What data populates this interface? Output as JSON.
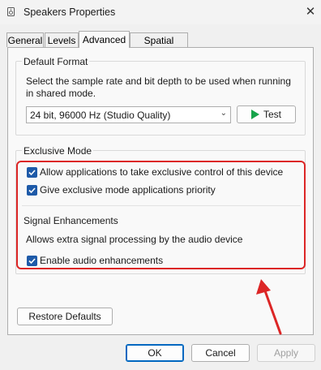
{
  "window": {
    "title": "Speakers Properties",
    "close_glyph": "✕"
  },
  "tabs": [
    {
      "label": "General"
    },
    {
      "label": "Levels"
    },
    {
      "label": "Advanced"
    },
    {
      "label": "Spatial sound"
    }
  ],
  "default_format": {
    "group_title": "Default Format",
    "description_line1": "Select the sample rate and bit depth to be used when running",
    "description_line2": "in shared mode.",
    "selected_format": "24 bit, 96000 Hz (Studio Quality)",
    "test_label": "Test"
  },
  "exclusive_mode": {
    "group_title": "Exclusive Mode",
    "allow_exclusive_label": "Allow applications to take exclusive control of this device",
    "allow_exclusive_checked": true,
    "priority_label": "Give exclusive mode applications priority",
    "priority_checked": true
  },
  "signal_enhancements": {
    "group_title": "Signal Enhancements",
    "description": "Allows extra signal processing by the audio device",
    "enable_label": "Enable audio enhancements",
    "enable_checked": true
  },
  "buttons": {
    "restore_defaults": "Restore Defaults",
    "ok": "OK",
    "cancel": "Cancel",
    "apply": "Apply"
  },
  "colors": {
    "highlight": "#dc2626",
    "checkbox": "#1e5aa8",
    "play_icon": "#16a34a"
  }
}
